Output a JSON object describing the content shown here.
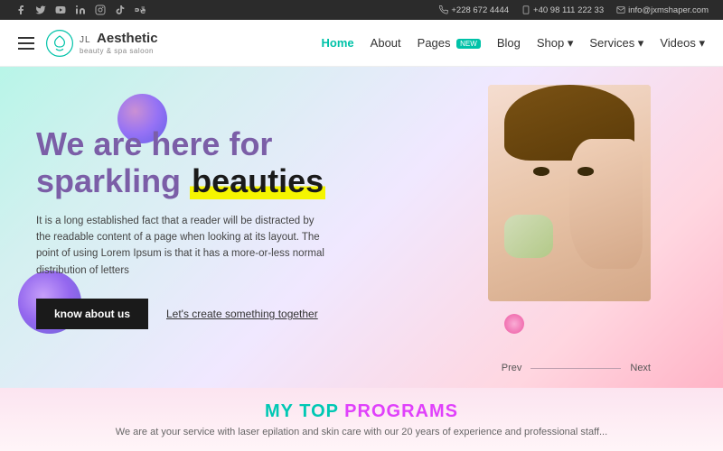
{
  "topbar": {
    "phone1": "+228 672 4444",
    "phone2": "+40 98 111 222 33",
    "email": "info@jxmshaper.com",
    "socials": [
      "f",
      "𝕏",
      "▶",
      "in",
      "📷",
      "🎵",
      "𝔹"
    ]
  },
  "navbar": {
    "logo_jl": "JL",
    "logo_name": "Aesthetic",
    "logo_subtitle": "beauty & spa saloon",
    "links": [
      {
        "label": "Home",
        "active": true,
        "badge": ""
      },
      {
        "label": "About",
        "active": false,
        "badge": ""
      },
      {
        "label": "Pages",
        "active": false,
        "badge": "NEW"
      },
      {
        "label": "Blog",
        "active": false,
        "badge": ""
      },
      {
        "label": "Shop",
        "active": false,
        "badge": "",
        "arrow": true
      },
      {
        "label": "Services",
        "active": false,
        "badge": "",
        "arrow": true
      },
      {
        "label": "Videos",
        "active": false,
        "badge": "",
        "arrow": true
      }
    ]
  },
  "hero": {
    "title_line1": "We are here for",
    "title_line2_pre": "sparkling",
    "title_line2_highlight": "beauties",
    "description": "It is a long established fact that a reader will be distracted by the readable content of a page when looking at its layout. The point of using Lorem Ipsum is that it has a more-or-less normal distribution of letters",
    "btn_know": "know about us",
    "btn_create": "Let's create something together",
    "prev_label": "Prev",
    "next_label": "Next"
  },
  "bottom": {
    "title_my_top": "MY TOP",
    "title_programs": "PROGRAMS",
    "description": "We are at your service with laser epilation and skin care with our 20 years of experience and professional staff..."
  }
}
